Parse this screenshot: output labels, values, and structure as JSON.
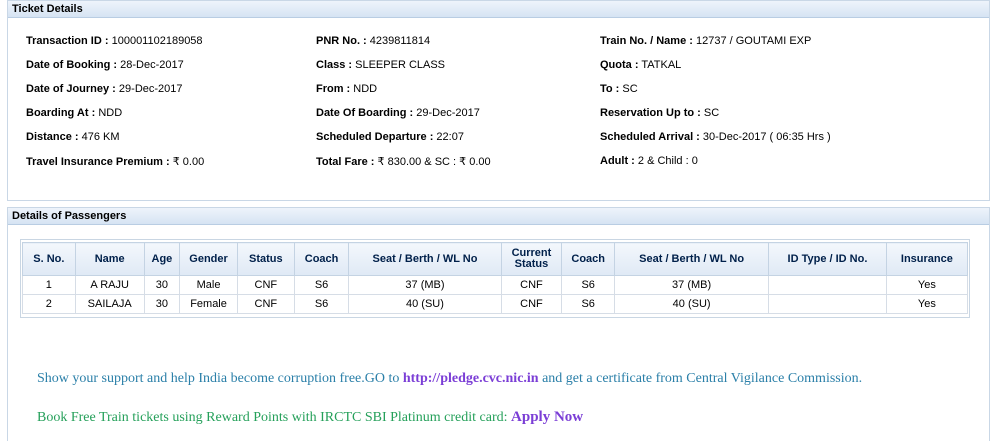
{
  "ticket_details": {
    "header": "Ticket Details",
    "rows": [
      [
        {
          "label": "Transaction ID :",
          "value": "100001102189058"
        },
        {
          "label": "PNR No. :",
          "value": "4239811814"
        },
        {
          "label": "Train No. / Name :",
          "value": "12737 / GOUTAMI EXP"
        }
      ],
      [
        {
          "label": "Date of Booking :",
          "value": "28-Dec-2017"
        },
        {
          "label": "Class :",
          "value": "SLEEPER CLASS"
        },
        {
          "label": "Quota :",
          "value": "TATKAL"
        }
      ],
      [
        {
          "label": "Date of Journey :",
          "value": "29-Dec-2017"
        },
        {
          "label": "From :",
          "value": "NDD"
        },
        {
          "label": "To :",
          "value": "SC"
        }
      ],
      [
        {
          "label": "Boarding At :",
          "value": "NDD"
        },
        {
          "label": "Date Of Boarding :",
          "value": "29-Dec-2017"
        },
        {
          "label": "Reservation Up to :",
          "value": "SC"
        }
      ],
      [
        {
          "label": "Distance :",
          "value": "476 KM"
        },
        {
          "label": "Scheduled Departure :",
          "value": "22:07"
        },
        {
          "label": "Scheduled Arrival :",
          "value": "30-Dec-2017 ( 06:35 Hrs )"
        }
      ],
      [
        {
          "label": "Travel Insurance Premium :",
          "value": "₹ 0.00"
        },
        {
          "label": "Total Fare :",
          "value": "₹ 830.00 & SC : ₹ 0.00"
        },
        {
          "label": "Adult :",
          "value": "2 & Child : 0"
        }
      ]
    ]
  },
  "passengers": {
    "header": "Details of Passengers",
    "columns": [
      "S. No.",
      "Name",
      "Age",
      "Gender",
      "Status",
      "Coach",
      "Seat / Berth / WL No",
      "Current Status",
      "Coach",
      "Seat / Berth / WL No",
      "ID Type / ID No.",
      "Insurance"
    ],
    "rows": [
      [
        "1",
        "A RAJU",
        "30",
        "Male",
        "CNF",
        "S6",
        "37 (MB)",
        "CNF",
        "S6",
        "37 (MB)",
        "",
        "Yes"
      ],
      [
        "2",
        "SAILAJA",
        "30",
        "Female",
        "CNF",
        "S6",
        "40 (SU)",
        "CNF",
        "S6",
        "40 (SU)",
        "",
        "Yes"
      ]
    ]
  },
  "promo": {
    "cvc_prefix": "Show your support and help India become corruption free.GO to ",
    "cvc_link": "http://pledge.cvc.nic.in",
    "cvc_suffix": " and get a certificate from Central Vigilance Commission.",
    "irctc_prefix": "Book Free Train tickets using Reward Points with IRCTC SBI Platinum credit card: ",
    "irctc_link": "Apply Now"
  },
  "colors": {
    "header_text": "#00204a",
    "cvc_text": "#2a7fa8",
    "irctc_text": "#25a05a",
    "link": "#7b3ed6"
  }
}
